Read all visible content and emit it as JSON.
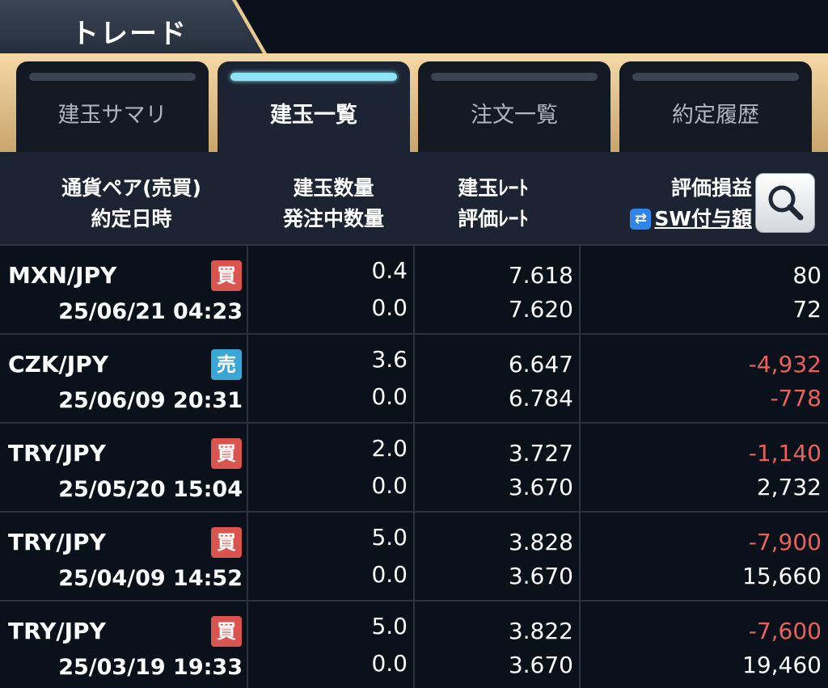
{
  "title": "トレード",
  "tabs": [
    {
      "label": "建玉サマリ",
      "active": false
    },
    {
      "label": "建玉一覧",
      "active": true
    },
    {
      "label": "注文一覧",
      "active": false
    },
    {
      "label": "約定履歴",
      "active": false
    }
  ],
  "header": {
    "col1_line1": "通貨ペア(売買)",
    "col1_line2": "約定日時",
    "col2_line1": "建玉数量",
    "col2_line2": "発注中数量",
    "col3_line1": "建玉ﾚｰﾄ",
    "col3_line2": "評価ﾚｰﾄ",
    "col4_line1": "評価損益",
    "col4_line2": "SW付与額",
    "sw_icon": "⇄"
  },
  "colors": {
    "buy": "#d9534f",
    "sell": "#3aa6d6",
    "negative": "#e8625d",
    "accent": "#8fe3f7"
  },
  "rows": [
    {
      "pair": "MXN/JPY",
      "side": "買",
      "side_type": "buy",
      "datetime": "25/06/21 04:23",
      "qty": "0.4",
      "pending_qty": "0.0",
      "open_rate": "7.618",
      "eval_rate": "7.620",
      "pl": "80",
      "pl_neg": false,
      "sw": "72",
      "sw_neg": false
    },
    {
      "pair": "CZK/JPY",
      "side": "売",
      "side_type": "sell",
      "datetime": "25/06/09 20:31",
      "qty": "3.6",
      "pending_qty": "0.0",
      "open_rate": "6.647",
      "eval_rate": "6.784",
      "pl": "-4,932",
      "pl_neg": true,
      "sw": "-778",
      "sw_neg": true
    },
    {
      "pair": "TRY/JPY",
      "side": "買",
      "side_type": "buy",
      "datetime": "25/05/20 15:04",
      "qty": "2.0",
      "pending_qty": "0.0",
      "open_rate": "3.727",
      "eval_rate": "3.670",
      "pl": "-1,140",
      "pl_neg": true,
      "sw": "2,732",
      "sw_neg": false
    },
    {
      "pair": "TRY/JPY",
      "side": "買",
      "side_type": "buy",
      "datetime": "25/04/09 14:52",
      "qty": "5.0",
      "pending_qty": "0.0",
      "open_rate": "3.828",
      "eval_rate": "3.670",
      "pl": "-7,900",
      "pl_neg": true,
      "sw": "15,660",
      "sw_neg": false
    },
    {
      "pair": "TRY/JPY",
      "side": "買",
      "side_type": "buy",
      "datetime": "25/03/19 19:33",
      "qty": "5.0",
      "pending_qty": "0.0",
      "open_rate": "3.822",
      "eval_rate": "3.670",
      "pl": "-7,600",
      "pl_neg": true,
      "sw": "19,460",
      "sw_neg": false
    }
  ]
}
